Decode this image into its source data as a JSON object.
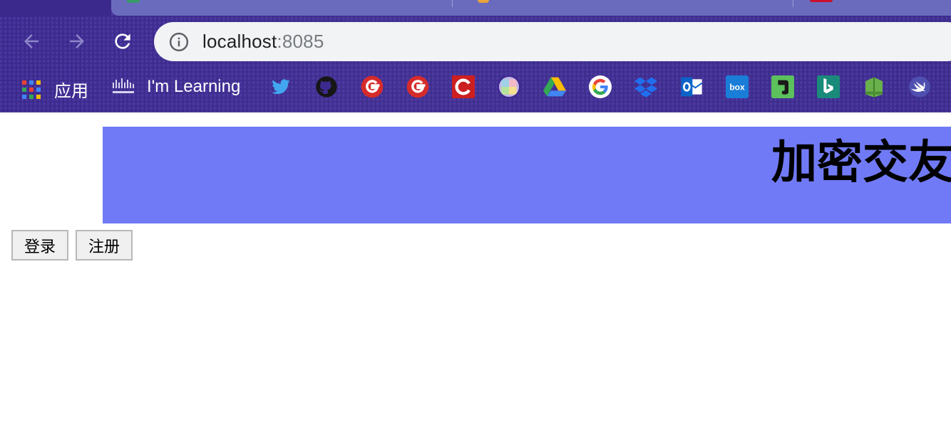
{
  "browser": {
    "address": {
      "host": "localhost",
      "port": ":8085"
    },
    "bookmarks": {
      "apps_label": "应用",
      "learning_label": "I'm Learning",
      "icons": [
        "twitter-icon",
        "github-icon",
        "g-red-icon-1",
        "g-red-icon-2",
        "c-red-icon",
        "color-ball-icon",
        "google-drive-icon",
        "google-icon",
        "dropbox-icon",
        "outlook-icon",
        "box-icon",
        "evernote-icon",
        "bing-icon",
        "green-book-icon",
        "swift-icon"
      ]
    },
    "colors": {
      "frame": "#3d2a8e",
      "tabstrip": "#6a6bbd",
      "omnibox": "#f1f3f4"
    }
  },
  "page": {
    "header": {
      "title": "加密交友"
    },
    "buttons": {
      "login": "登录",
      "register": "注册"
    },
    "colors": {
      "banner": "#717af6"
    }
  }
}
